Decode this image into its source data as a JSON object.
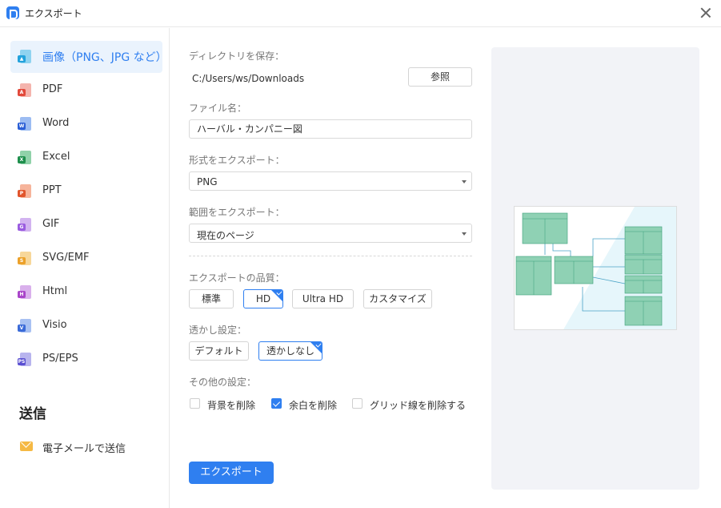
{
  "window": {
    "title": "エクスポート"
  },
  "sidebar": {
    "items": [
      {
        "label": "画像（PNG、JPG など）",
        "active": true
      },
      {
        "label": "PDF"
      },
      {
        "label": "Word"
      },
      {
        "label": "Excel"
      },
      {
        "label": "PPT"
      },
      {
        "label": "GIF"
      },
      {
        "label": "SVG/EMF"
      },
      {
        "label": "Html"
      },
      {
        "label": "Visio"
      },
      {
        "label": "PS/EPS"
      }
    ],
    "send_title": "送信",
    "email_label": "電子メールで送信"
  },
  "form": {
    "dir_label": "ディレクトリを保存：",
    "dir_path": "C:/Users/ws/Downloads",
    "browse_label": "参照",
    "filename_label": "ファイル名：",
    "filename_value": "ハーバル・カンパニー図",
    "format_label": "形式をエクスポート：",
    "format_value": "PNG",
    "range_label": "範囲をエクスポート：",
    "range_value": "現在のページ",
    "quality_label": "エクスポートの品質：",
    "quality_options": [
      "標準",
      "HD",
      "Ultra HD",
      "カスタマイズ"
    ],
    "quality_selected": "HD",
    "watermark_label": "透かし設定：",
    "watermark_options": [
      "デフォルト",
      "透かしなし"
    ],
    "watermark_selected": "透かしなし",
    "other_label": "その他の設定：",
    "other_options": [
      {
        "label": "背景を削除",
        "checked": false
      },
      {
        "label": "余白を削除",
        "checked": true
      },
      {
        "label": "グリッド線を削除する",
        "checked": false
      }
    ],
    "export_label": "エクスポート"
  },
  "colors": {
    "accent": "#2f7ff0",
    "diagram_fill": "#8fd1b4",
    "diagram_stroke": "#3da07b",
    "diagram_line": "#4aa3c6"
  }
}
